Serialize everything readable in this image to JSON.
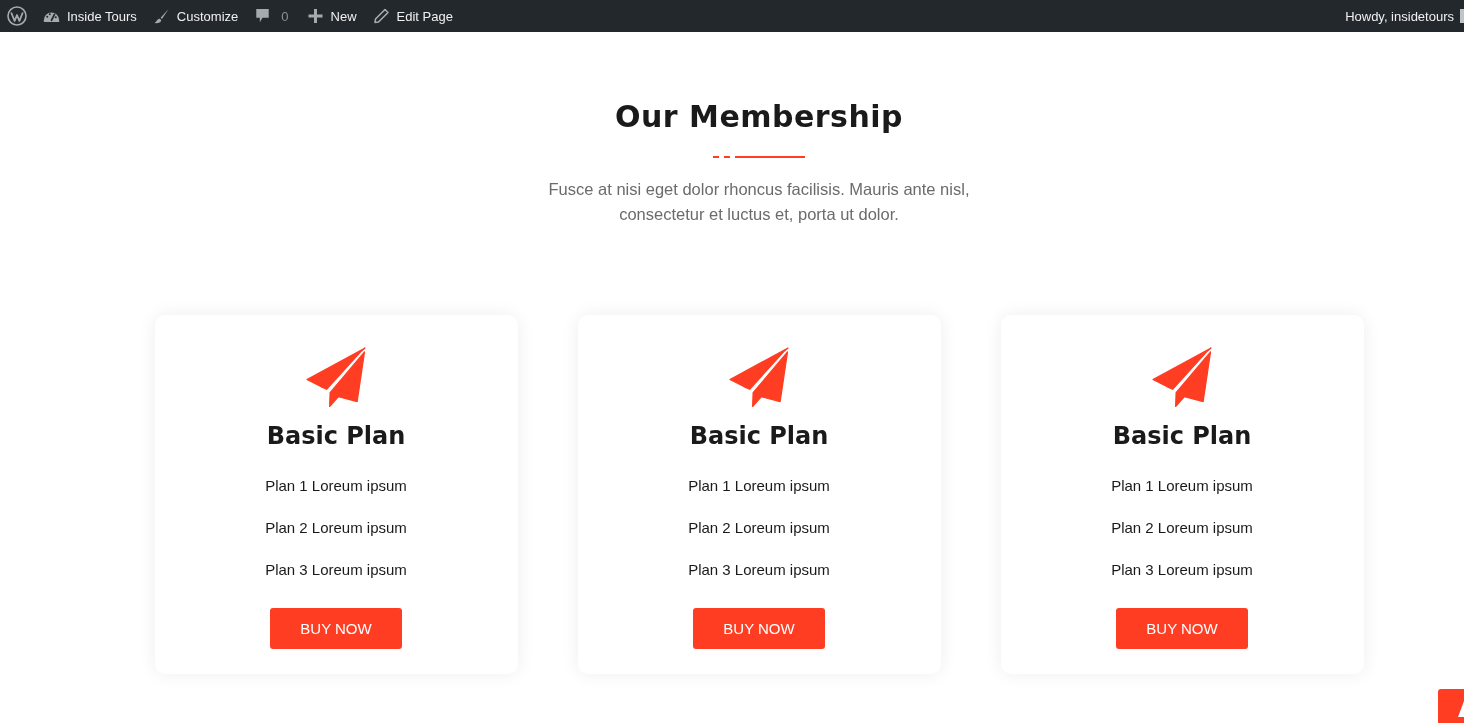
{
  "admin_bar": {
    "items": [
      {
        "kind": "logo"
      },
      {
        "kind": "site",
        "label": "Inside Tours"
      },
      {
        "kind": "customize",
        "label": "Customize"
      },
      {
        "kind": "comments",
        "label": "0"
      },
      {
        "kind": "new",
        "label": "New"
      },
      {
        "kind": "edit",
        "label": "Edit Page"
      }
    ],
    "greeting": "Howdy, insidetours"
  },
  "section": {
    "title": "Our Membership",
    "description": "Fusce at nisi eget dolor rhoncus facilisis. Mauris ante nisl, consectetur et luctus et, porta ut dolor."
  },
  "plans": [
    {
      "title": "Basic Plan",
      "features": [
        "Plan 1 Loreum ipsum",
        "Plan 2 Loreum ipsum",
        "Plan 3 Loreum ipsum"
      ],
      "button": "BUY NOW"
    },
    {
      "title": "Basic Plan",
      "features": [
        "Plan 1 Loreum ipsum",
        "Plan 2 Loreum ipsum",
        "Plan 3 Loreum ipsum"
      ],
      "button": "BUY NOW"
    },
    {
      "title": "Basic Plan",
      "features": [
        "Plan 1 Loreum ipsum",
        "Plan 2 Loreum ipsum",
        "Plan 3 Loreum ipsum"
      ],
      "button": "BUY NOW"
    }
  ]
}
